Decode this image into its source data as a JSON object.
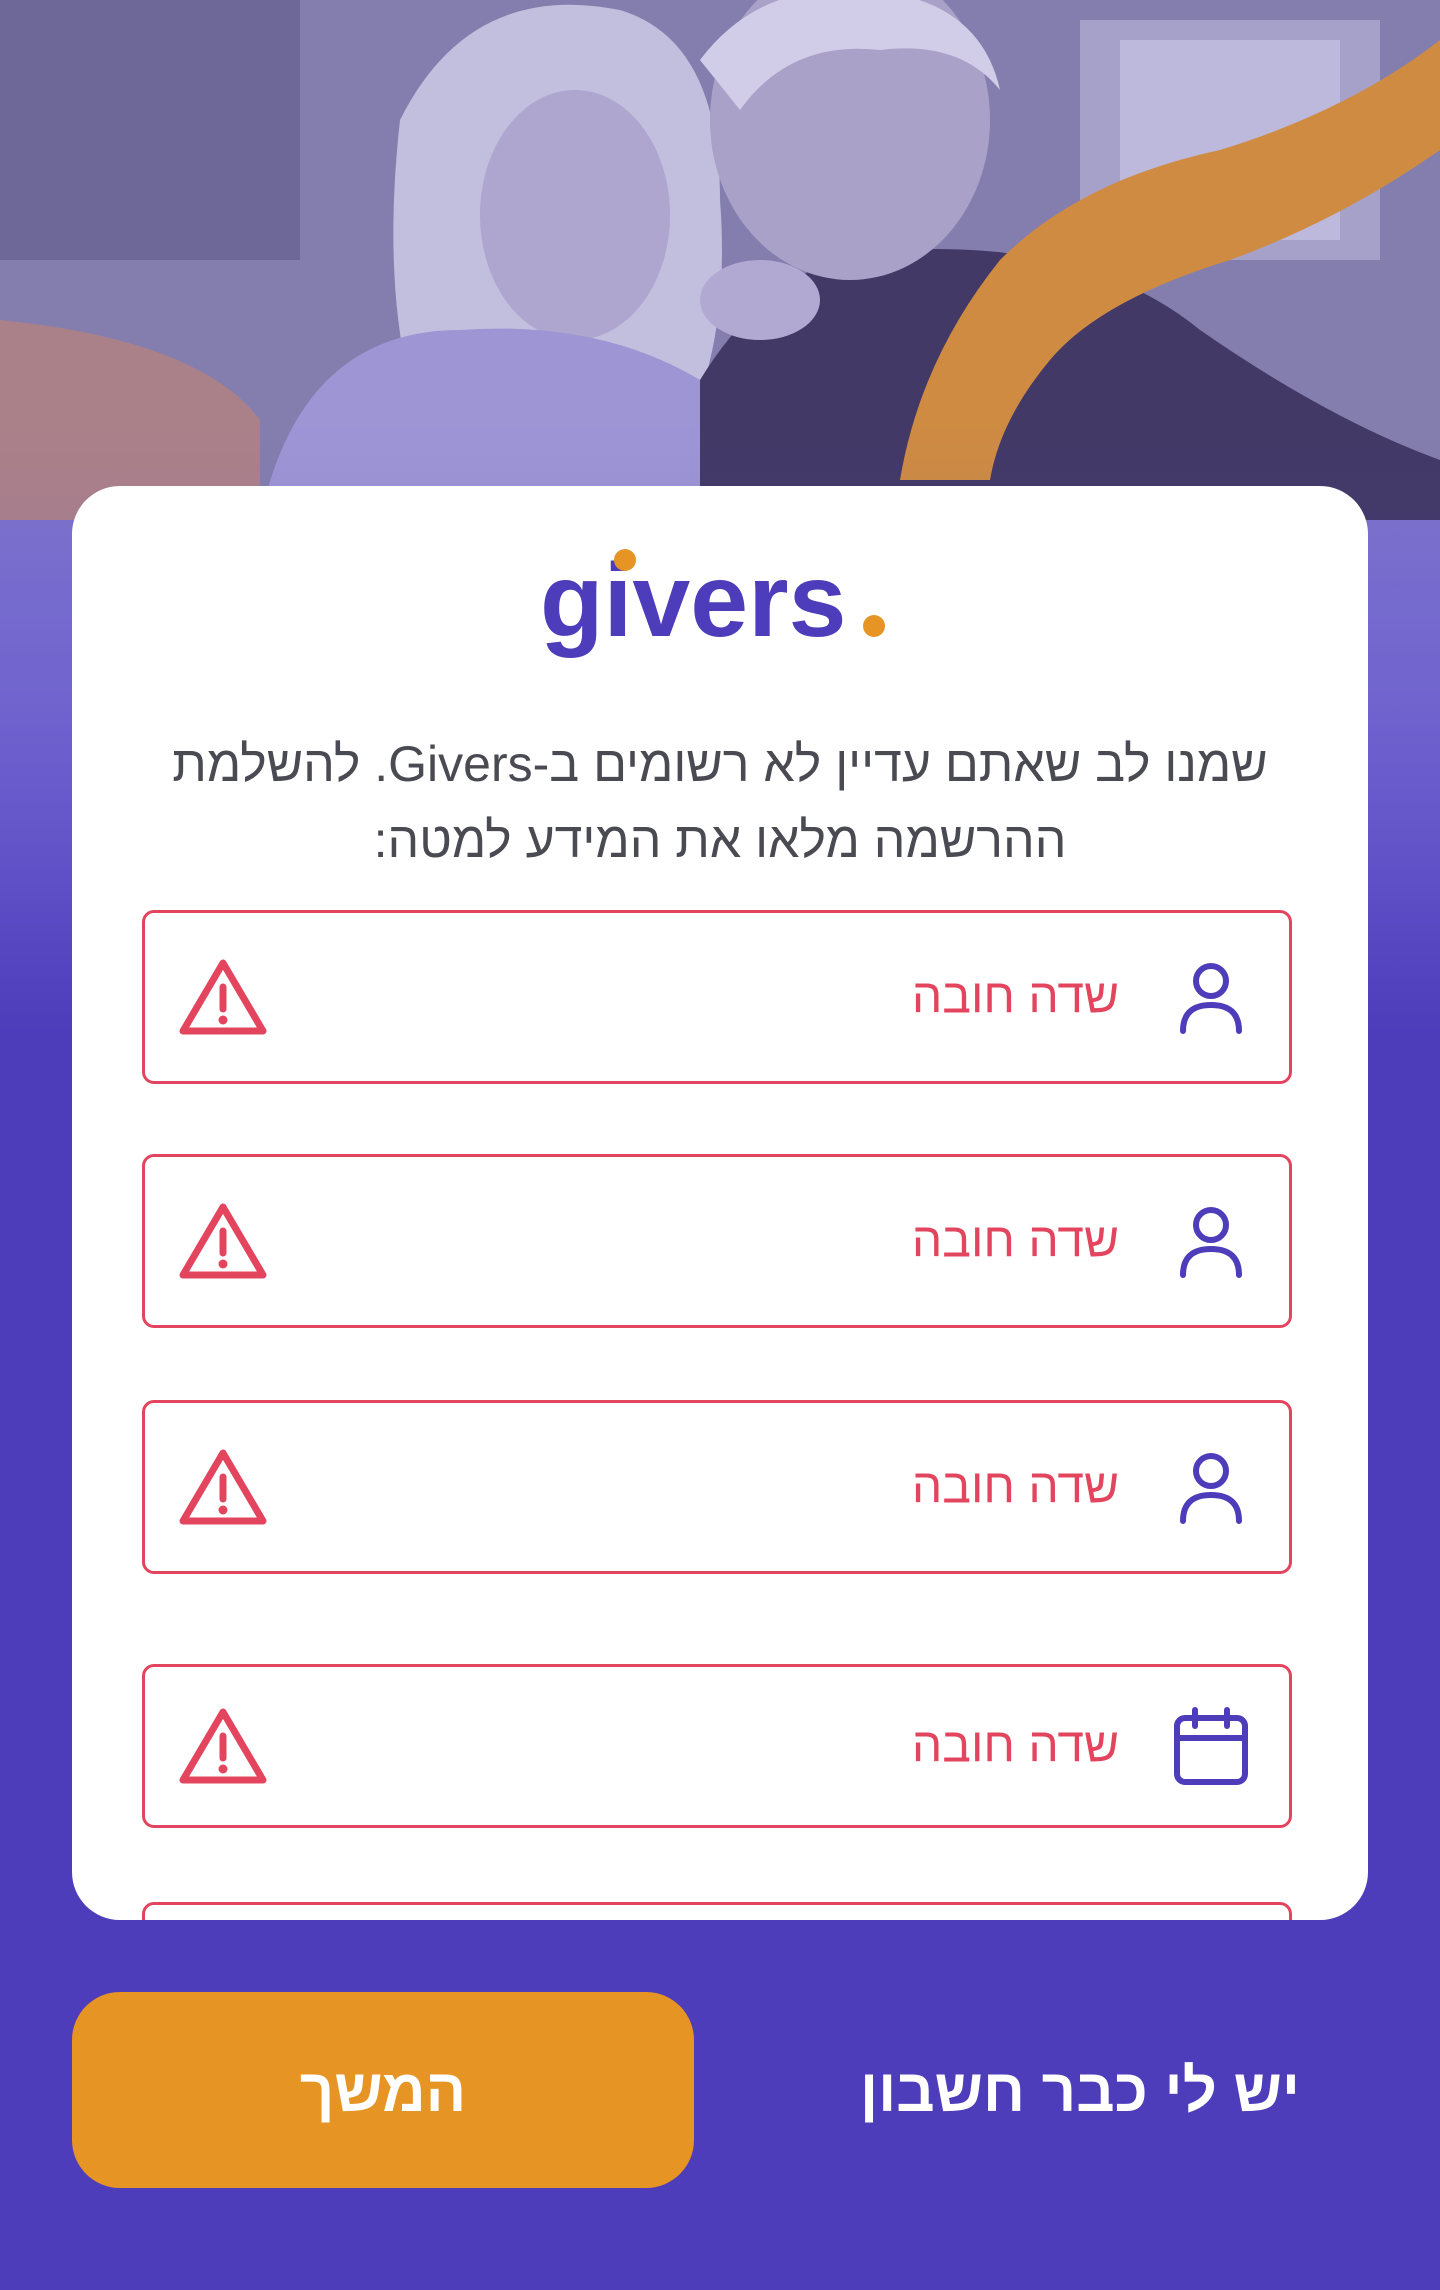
{
  "brand": {
    "logo_text": "givers",
    "logo_dot_color": "#e69524",
    "logo_text_color": "#4d3dba",
    "accent_color": "#e69524",
    "primary_color": "#4d3dba",
    "error_color": "#e3455f"
  },
  "intro_text": "שמנו לב שאתם עדיין לא רשומים ב-Givers. להשלמת ההרשמה מלאו את המידע למטה:",
  "fields": [
    {
      "icon": "person-icon",
      "error": "שדה חובה"
    },
    {
      "icon": "person-icon",
      "error": "שדה חובה"
    },
    {
      "icon": "person-icon",
      "error": "שדה חובה"
    },
    {
      "icon": "calendar-icon",
      "error": "שדה חובה"
    }
  ],
  "actions": {
    "continue_label": "המשך",
    "have_account_label": "יש לי כבר חשבון"
  }
}
